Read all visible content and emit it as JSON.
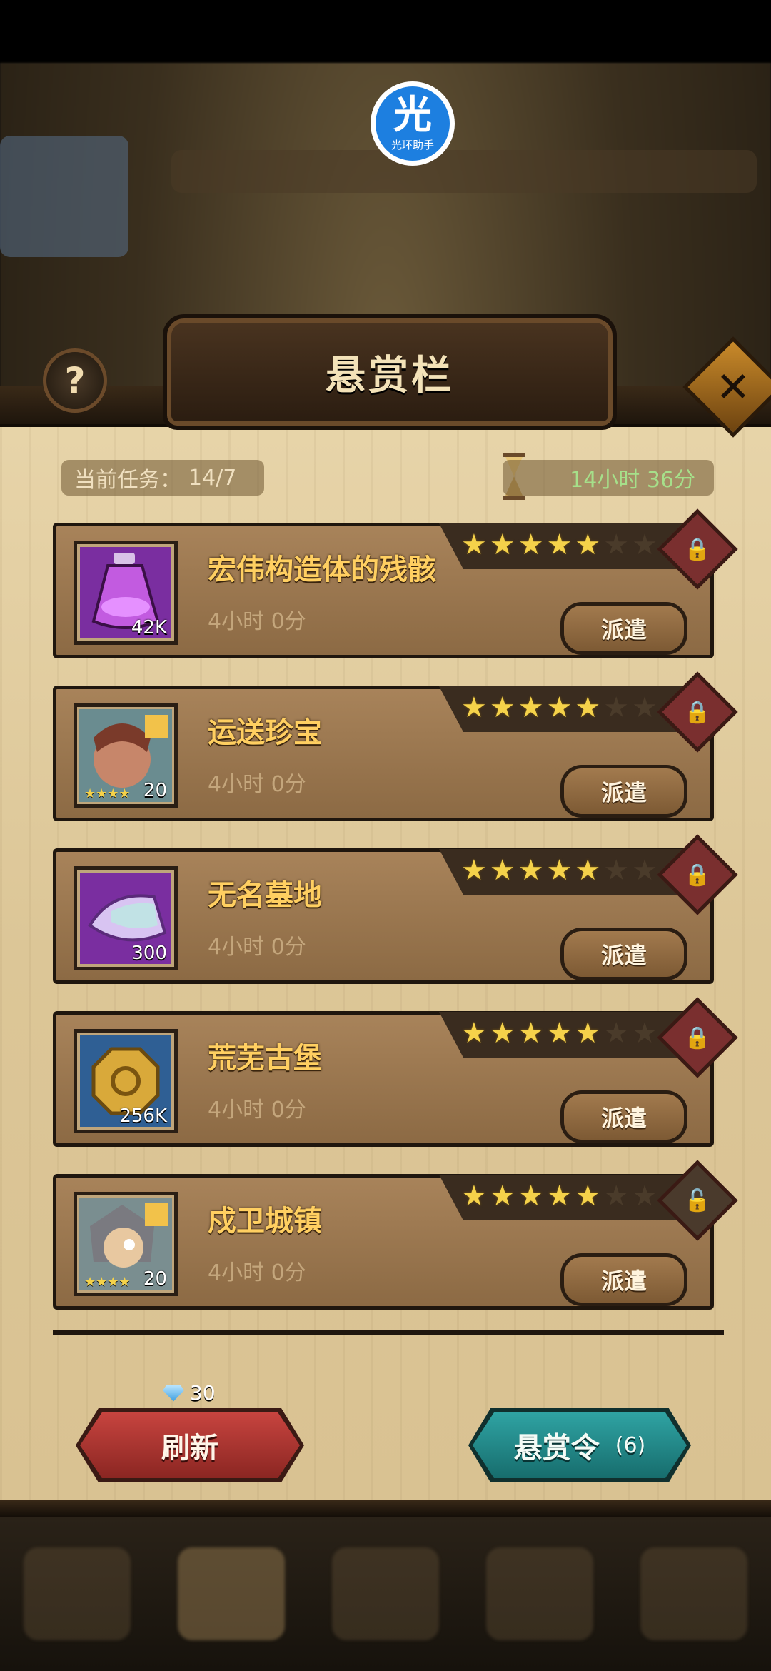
{
  "overlay_badge": {
    "glyph": "光",
    "label": "光环助手"
  },
  "header": {
    "title": "悬赏栏",
    "help": "?",
    "close": "✕"
  },
  "status": {
    "task_label": "当前任务：",
    "task_value": "14/7",
    "timer": "14小时 36分"
  },
  "quests": [
    {
      "name": "宏伟构造体的残骸",
      "time": "4小时 0分",
      "stars": 5,
      "max_stars": 7,
      "reward_qty": "42K",
      "reward_icon": "purple-potion-icon",
      "frame_color": "#8a2fb0",
      "locked": true,
      "dispatch": "派遣"
    },
    {
      "name": "运送珍宝",
      "time": "4小时 0分",
      "stars": 5,
      "max_stars": 7,
      "reward_qty": "20",
      "reward_stars": "★★★★",
      "reward_icon": "hero-portrait-icon",
      "frame_color": "#4b6f78",
      "locked": true,
      "dispatch": "派遣"
    },
    {
      "name": "无名墓地",
      "time": "4小时 0分",
      "stars": 5,
      "max_stars": 7,
      "reward_qty": "300",
      "reward_icon": "crystal-shard-icon",
      "frame_color": "#8a2fb0",
      "locked": true,
      "dispatch": "派遣"
    },
    {
      "name": "荒芜古堡",
      "time": "4小时 0分",
      "stars": 5,
      "max_stars": 7,
      "reward_qty": "256K",
      "reward_icon": "gold-coin-icon",
      "frame_color": "#2f6aa0",
      "locked": true,
      "dispatch": "派遣"
    },
    {
      "name": "戍卫城镇",
      "time": "4小时 0分",
      "stars": 5,
      "max_stars": 7,
      "reward_qty": "20",
      "reward_stars": "★★★★",
      "reward_icon": "hero-portrait-icon",
      "frame_color": "#4b6f78",
      "locked": false,
      "dispatch": "派遣"
    }
  ],
  "footer": {
    "refresh_cost": "30",
    "refresh_label": "刷新",
    "order_label": "悬赏令",
    "order_count": "(6)"
  }
}
